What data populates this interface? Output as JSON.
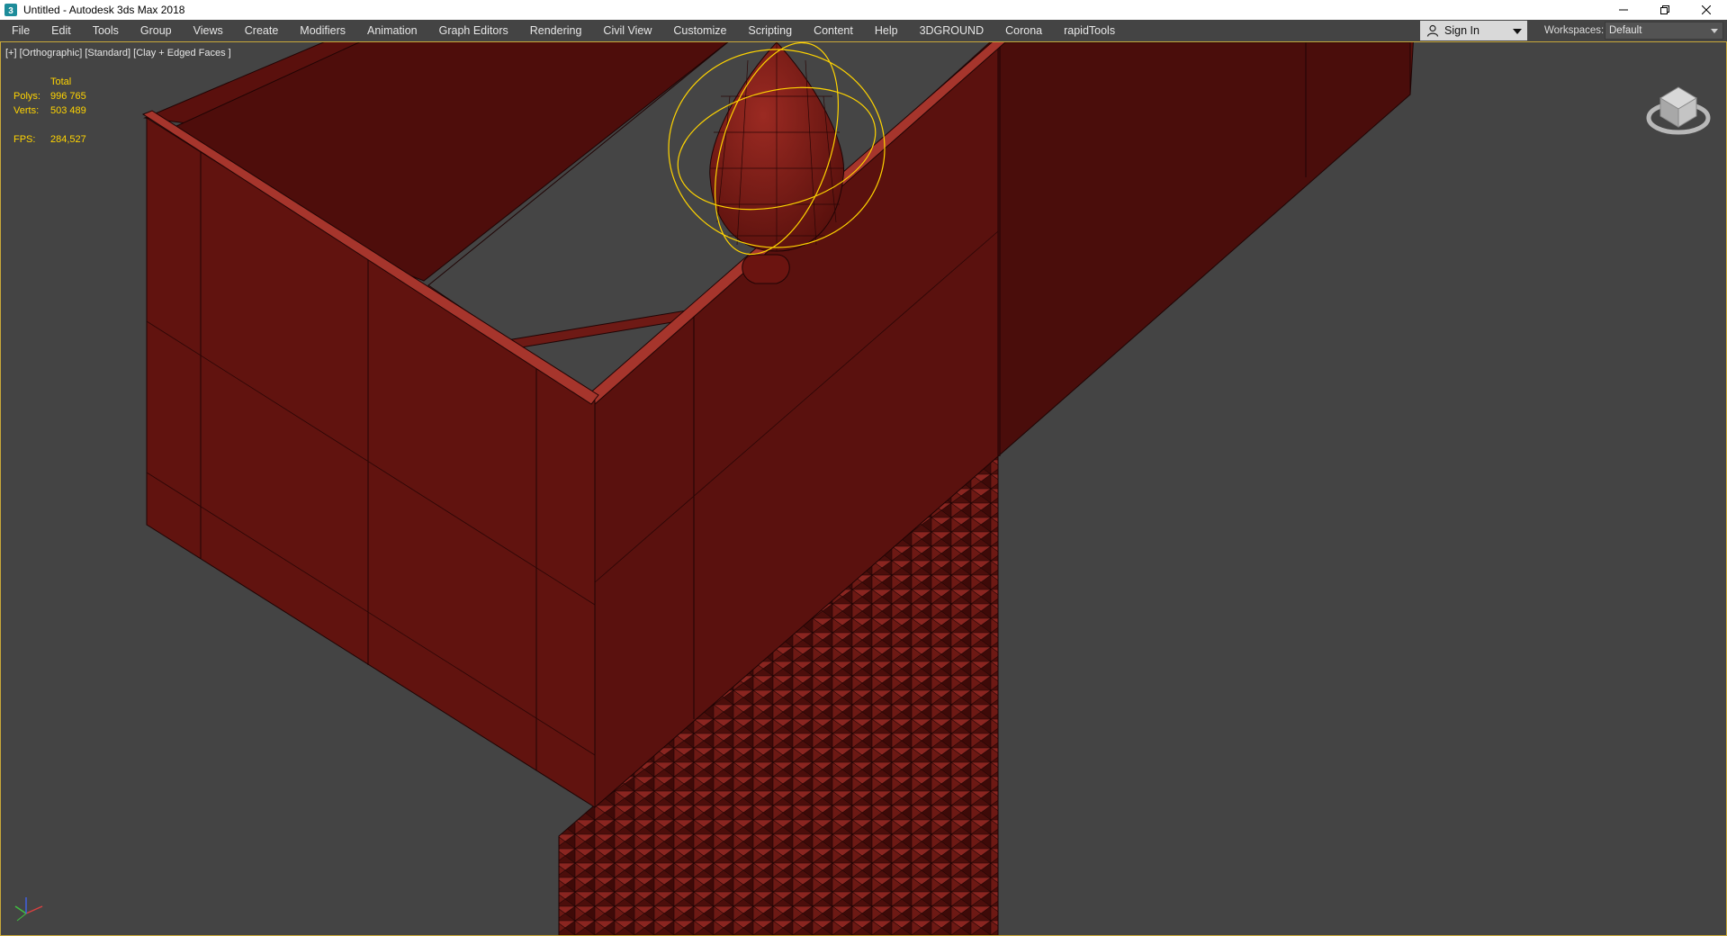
{
  "window": {
    "title": "Untitled - Autodesk 3ds Max 2018",
    "app_icon": "3dsmax-logo-icon",
    "controls": [
      "minimize-icon",
      "restore-icon",
      "close-icon"
    ]
  },
  "menubar": {
    "items": [
      "File",
      "Edit",
      "Tools",
      "Group",
      "Views",
      "Create",
      "Modifiers",
      "Animation",
      "Graph Editors",
      "Rendering",
      "Civil View",
      "Customize",
      "Scripting",
      "Content",
      "Help",
      "3DGROUND",
      "Corona",
      "rapidTools"
    ],
    "sign_in": "Sign In",
    "workspaces_label": "Workspaces:",
    "workspace_value": "Default"
  },
  "viewport": {
    "label": "[+] [Orthographic] [Standard] [Clay + Edged Faces ]",
    "stats": {
      "header": "Total",
      "polys_label": "Polys:",
      "polys_value": "996 765",
      "verts_label": "Verts:",
      "verts_value": "503 489",
      "fps_label": "FPS:",
      "fps_value": "284,527"
    },
    "colors": {
      "background": "#444444",
      "clay_red": "#6b1410",
      "clay_dark": "#4a0d0b",
      "selection": "#ffd400",
      "active_border": "#c8a83a"
    },
    "viewcube": "viewcube-icon",
    "axis": "axis-tripod-icon"
  }
}
